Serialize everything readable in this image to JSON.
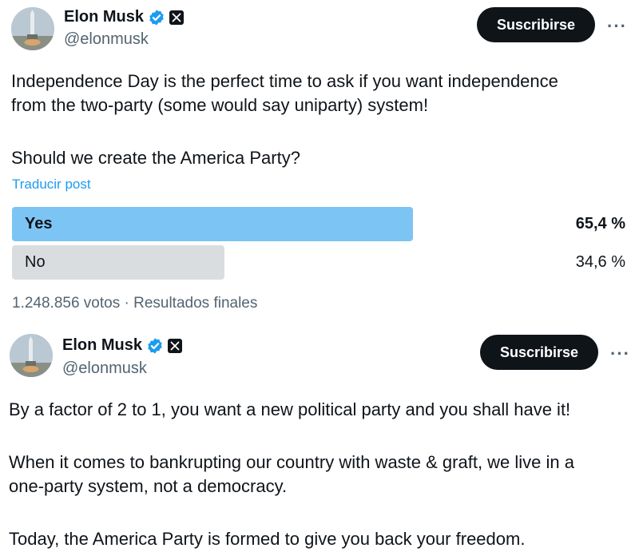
{
  "colors": {
    "winner_bar": "#7cc4f4",
    "other_bar": "#d9dde0",
    "verified": "#1d9bf0",
    "link": "#1d9bf0"
  },
  "tweet1": {
    "author": {
      "name": "Elon Musk",
      "handle": "@elonmusk",
      "verified_icon": "verified-badge-icon",
      "affiliate_icon": "x-logo-icon"
    },
    "subscribe_label": "Suscribirse",
    "more_label": "···",
    "text_lines": [
      "Independence Day is the perfect time to ask if you want independence",
      "from the two-party (some would say uniparty) system!",
      "Should we create the America Party?"
    ],
    "translate_label": "Traducir post",
    "poll": {
      "options": [
        {
          "label": "Yes",
          "percent": "65,4 %",
          "fill": 0.654,
          "winner": true
        },
        {
          "label": "No",
          "percent": "34,6 %",
          "fill": 0.346,
          "winner": false
        }
      ],
      "votes": "1.248.856 votos",
      "separator": "·",
      "status": "Resultados finales"
    }
  },
  "tweet2": {
    "author": {
      "name": "Elon Musk",
      "handle": "@elonmusk",
      "verified_icon": "verified-badge-icon",
      "affiliate_icon": "x-logo-icon"
    },
    "subscribe_label": "Suscribirse",
    "more_label": "···",
    "text_lines": [
      "By a factor of 2 to 1, you want a new political party and you shall have it!",
      "When it comes to bankrupting our country with waste & graft, we live in a",
      "one-party system, not a democracy.",
      "Today, the America Party is formed to give you back your freedom."
    ]
  }
}
